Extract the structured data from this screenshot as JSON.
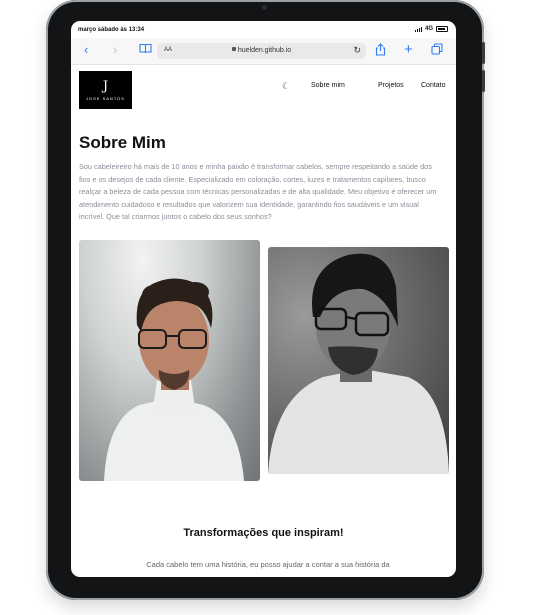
{
  "statusbar": {
    "time": "março sábado às 13:34",
    "network": "4G"
  },
  "browser": {
    "aa_label": "AA",
    "url": "huelden.github.io",
    "icons": [
      "chevron-left-icon",
      "chevron-right-icon",
      "book-icon",
      "reload-icon",
      "share-icon",
      "plus-icon",
      "tabs-icon"
    ]
  },
  "header": {
    "logo_mark": "J",
    "logo_name": "JOSE SANTOS",
    "nav": [
      "Sobre mim",
      "Projetos",
      "Contato"
    ]
  },
  "about": {
    "title": "Sobre Mim",
    "text": "Sou cabeleireiro há mais de 10 anos e minha paixão é transformar cabelos, sempre respeitando a saúde dos fios e os desejos de cada cliente. Especializado em coloração, cortes, luzes e tratamentos capilares, busco realçar a beleza de cada pessoa com técnicas personalizadas e de alta qualidade. Meu objetivo é oferecer um atendimento cuidadoso e resultados que valorizem sua identidade, garantindo fios saudáveis e um visual incrível. Que tal criarmos juntos o cabelo dos seus sonhos?"
  },
  "section2": {
    "title": "Transformações que inspiram!",
    "text": "Cada cabelo tem uma história, eu posso ajudar a contar a sua história da"
  }
}
